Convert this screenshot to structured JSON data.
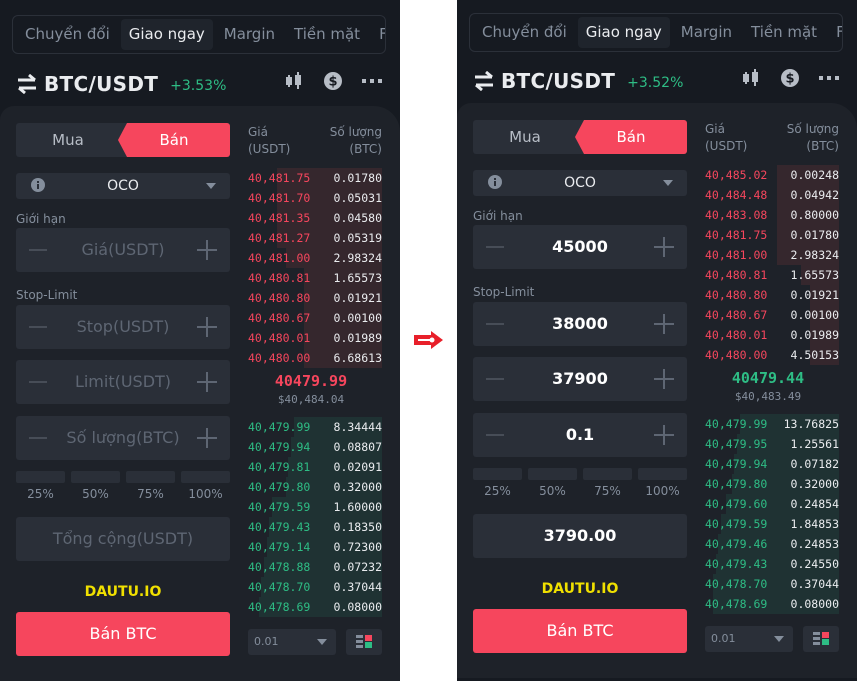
{
  "arrow_icon": "right-arrow-icon",
  "screens": [
    {
      "tabs": [
        "Chuyển đổi",
        "Giao ngay",
        "Margin",
        "Tiền mặt",
        "F"
      ],
      "active_tab": "Giao ngay",
      "pair": "BTC/USDT",
      "change": "+3.53%",
      "side_toggle": {
        "buy": "Mua",
        "sell": "Bán",
        "active": "sell"
      },
      "order_type": "OCO",
      "limit_label": "Giới hạn",
      "stop_limit_label": "Stop-Limit",
      "price_field": {
        "value": "",
        "placeholder": "Giá(USDT)"
      },
      "stop_field": {
        "value": "",
        "placeholder": "Stop(USDT)"
      },
      "limit_field": {
        "value": "",
        "placeholder": "Limit(USDT)"
      },
      "amount_field": {
        "value": "",
        "placeholder": "Số lượng(BTC)"
      },
      "percent_options": [
        "25%",
        "50%",
        "75%",
        "100%"
      ],
      "total_field": {
        "value": "",
        "placeholder": "Tổng cộng(USDT)"
      },
      "watermark": "DAUTU.IO",
      "submit_label": "Bán BTC",
      "orderbook": {
        "header_price": "Giá\n(USDT)",
        "header_price_1": "Giá",
        "header_price_2": "(USDT)",
        "header_qty_1": "Số lượng",
        "header_qty_2": "(BTC)",
        "asks": [
          {
            "price": "40,481.75",
            "qty": "0.01780",
            "depth": 0.78
          },
          {
            "price": "40,481.70",
            "qty": "0.05031",
            "depth": 0.78
          },
          {
            "price": "40,481.35",
            "qty": "0.04580",
            "depth": 0.78
          },
          {
            "price": "40,481.27",
            "qty": "0.05319",
            "depth": 0.78
          },
          {
            "price": "40,481.00",
            "qty": "2.98324",
            "depth": 0.72
          },
          {
            "price": "40,480.81",
            "qty": "1.65573",
            "depth": 0.58
          },
          {
            "price": "40,480.80",
            "qty": "0.01921",
            "depth": 0.58
          },
          {
            "price": "40,480.67",
            "qty": "0.00100",
            "depth": 0.58
          },
          {
            "price": "40,480.01",
            "qty": "0.01989",
            "depth": 0.58
          },
          {
            "price": "40,480.00",
            "qty": "6.68613",
            "depth": 0.58
          }
        ],
        "last_price": "40479.99",
        "last_direction": "down",
        "fiat_price": "$40,484.04",
        "bids": [
          {
            "price": "40,479.99",
            "qty": "8.34444",
            "depth": 0.66
          },
          {
            "price": "40,479.94",
            "qty": "0.08807",
            "depth": 0.68
          },
          {
            "price": "40,479.81",
            "qty": "0.02091",
            "depth": 0.7
          },
          {
            "price": "40,479.80",
            "qty": "0.32000",
            "depth": 0.72
          },
          {
            "price": "40,479.59",
            "qty": "1.60000",
            "depth": 0.82
          },
          {
            "price": "40,479.43",
            "qty": "0.18350",
            "depth": 0.84
          },
          {
            "price": "40,479.14",
            "qty": "0.72300",
            "depth": 0.86
          },
          {
            "price": "40,478.88",
            "qty": "0.07232",
            "depth": 0.88
          },
          {
            "price": "40,478.70",
            "qty": "0.37044",
            "depth": 0.9
          },
          {
            "price": "40,478.69",
            "qty": "0.08000",
            "depth": 0.92
          }
        ],
        "precision": "0.01"
      }
    },
    {
      "tabs": [
        "Chuyển đổi",
        "Giao ngay",
        "Margin",
        "Tiền mặt",
        "F"
      ],
      "active_tab": "Giao ngay",
      "pair": "BTC/USDT",
      "change": "+3.52%",
      "side_toggle": {
        "buy": "Mua",
        "sell": "Bán",
        "active": "sell"
      },
      "order_type": "OCO",
      "limit_label": "Giới hạn",
      "stop_limit_label": "Stop-Limit",
      "price_field": {
        "value": "45000",
        "placeholder": "Giá(USDT)"
      },
      "stop_field": {
        "value": "38000",
        "placeholder": "Stop(USDT)"
      },
      "limit_field": {
        "value": "37900",
        "placeholder": "Limit(USDT)"
      },
      "amount_field": {
        "value": "0.1",
        "placeholder": "Số lượng(BTC)"
      },
      "percent_options": [
        "25%",
        "50%",
        "75%",
        "100%"
      ],
      "total_field": {
        "value": "3790.00",
        "placeholder": "Tổng cộng(USDT)"
      },
      "watermark": "DAUTU.IO",
      "submit_label": "Bán BTC",
      "orderbook": {
        "header_price_1": "Giá",
        "header_price_2": "(USDT)",
        "header_qty_1": "Số lượng",
        "header_qty_2": "(BTC)",
        "asks": [
          {
            "price": "40,485.02",
            "qty": "0.00248",
            "depth": 0.46
          },
          {
            "price": "40,484.48",
            "qty": "0.04942",
            "depth": 0.46
          },
          {
            "price": "40,483.08",
            "qty": "0.80000",
            "depth": 0.46
          },
          {
            "price": "40,481.75",
            "qty": "0.01780",
            "depth": 0.46
          },
          {
            "price": "40,481.00",
            "qty": "2.98324",
            "depth": 0.46
          },
          {
            "price": "40,480.81",
            "qty": "1.65573",
            "depth": 0.28
          },
          {
            "price": "40,480.80",
            "qty": "0.01921",
            "depth": 0.22
          },
          {
            "price": "40,480.67",
            "qty": "0.00100",
            "depth": 0.22
          },
          {
            "price": "40,480.01",
            "qty": "0.01989",
            "depth": 0.22
          },
          {
            "price": "40,480.00",
            "qty": "4.50153",
            "depth": 0.22
          }
        ],
        "last_price": "40479.44",
        "last_direction": "up",
        "fiat_price": "$40,483.49",
        "bids": [
          {
            "price": "40,479.99",
            "qty": "13.76825",
            "depth": 0.74
          },
          {
            "price": "40,479.95",
            "qty": "1.25561",
            "depth": 0.76
          },
          {
            "price": "40,479.94",
            "qty": "0.07182",
            "depth": 0.78
          },
          {
            "price": "40,479.80",
            "qty": "0.32000",
            "depth": 0.8
          },
          {
            "price": "40,479.60",
            "qty": "0.24854",
            "depth": 0.84
          },
          {
            "price": "40,479.59",
            "qty": "1.84853",
            "depth": 0.88
          },
          {
            "price": "40,479.46",
            "qty": "0.24853",
            "depth": 0.9
          },
          {
            "price": "40,479.43",
            "qty": "0.24550",
            "depth": 0.92
          },
          {
            "price": "40,478.70",
            "qty": "0.37044",
            "depth": 0.94
          },
          {
            "price": "40,478.69",
            "qty": "0.08000",
            "depth": 0.94
          }
        ],
        "precision": "0.01"
      }
    }
  ],
  "colors": {
    "sell": "#f6465d",
    "buy": "#2ebd85",
    "watermark": "#f0e000",
    "arrow": "#e8202a"
  }
}
